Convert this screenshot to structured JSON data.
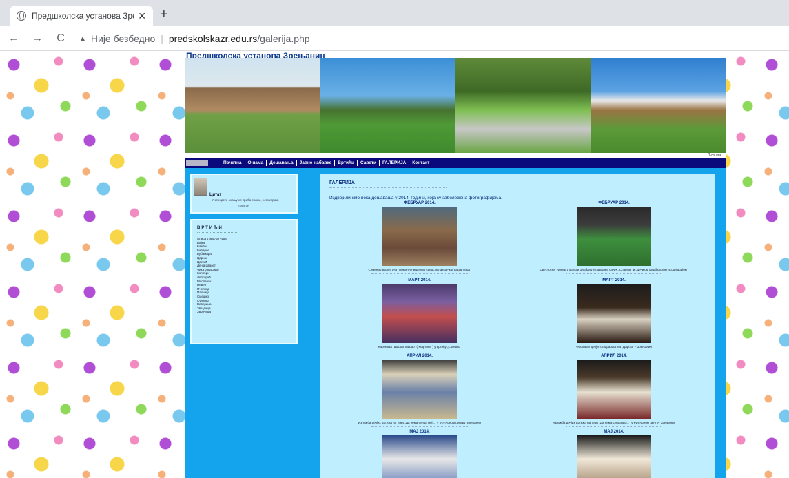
{
  "browser": {
    "tab_title": "Предшколска установа Зрењан",
    "tab_close": "✕",
    "new_tab": "+",
    "back": "←",
    "forward": "→",
    "reload": "C",
    "security_label": "Није безбедно",
    "url_domain": "predskolskazr.edu.rs",
    "url_path": "/galerija.php"
  },
  "site": {
    "title": "Предшколска установа Зрењанин",
    "top_small_link": "Почетна",
    "nav": [
      "Почетна",
      "О нама",
      "Дешавања",
      "Јавне набавке",
      "Вртићи",
      "Савети",
      "ГАЛЕРИЈА",
      "Контакт"
    ]
  },
  "sidebar": {
    "quote_title": "Цитат",
    "quote_text": "Учити дете знању не треба силом, него игром.",
    "quote_author": "Платон",
    "kindergartens_title": "ВРТИЋИ",
    "kindergartens": [
      "Алиса у земљи чуда",
      "Бајка",
      "Бамби",
      "Бибарче",
      "Бубамара",
      "Цврчак",
      "Цветић",
      "Дечја радост",
      "Чика Јова Змај",
      "Колибри",
      "Лептирић",
      "Маслачак",
      "Невен",
      "Пчелица",
      "Палчица",
      "Смешко",
      "Сунчица",
      "Веверица",
      "Звездица",
      "Звончица"
    ]
  },
  "main": {
    "heading": "ГАЛЕРИЈА",
    "intro": "Издвојили смо нека дешавања у 2014. години, која су забележена фотографијама.",
    "items": [
      {
        "month": "ФЕБРУАР 2014.",
        "caption": "Семинар васпитача \"Покретне игре као средство физичког васпитања\""
      },
      {
        "month": "ФЕБРУАР 2014.",
        "caption": "Светлосни турнир у малом фудбалу у сарадњи са ФК „Спартак\" и „Дечијом фудбалском асоцијацијом\""
      },
      {
        "month": "МАРТ 2014.",
        "caption": "Карневал \"Шашав вашар\" (\"Мартини\") у вртићу „Смешко\""
      },
      {
        "month": "МАРТ 2014.",
        "caption": "Фестивал дечјег стваралаштва „Царски\" - Зрењанин"
      },
      {
        "month": "АПРИЛ 2014.",
        "caption": "Изложба дечјих цртежа на тему „Да нема сунца мој...\" у Културном центру Зрењанин"
      },
      {
        "month": "АПРИЛ 2014.",
        "caption": "Изложба дечјих цртежа на тему „Да нема сунца мој...\" у Културном центру Зрењанин"
      },
      {
        "month": "МАЈ 2014.",
        "caption": ""
      },
      {
        "month": "МАЈ 2014.",
        "caption": ""
      }
    ]
  }
}
